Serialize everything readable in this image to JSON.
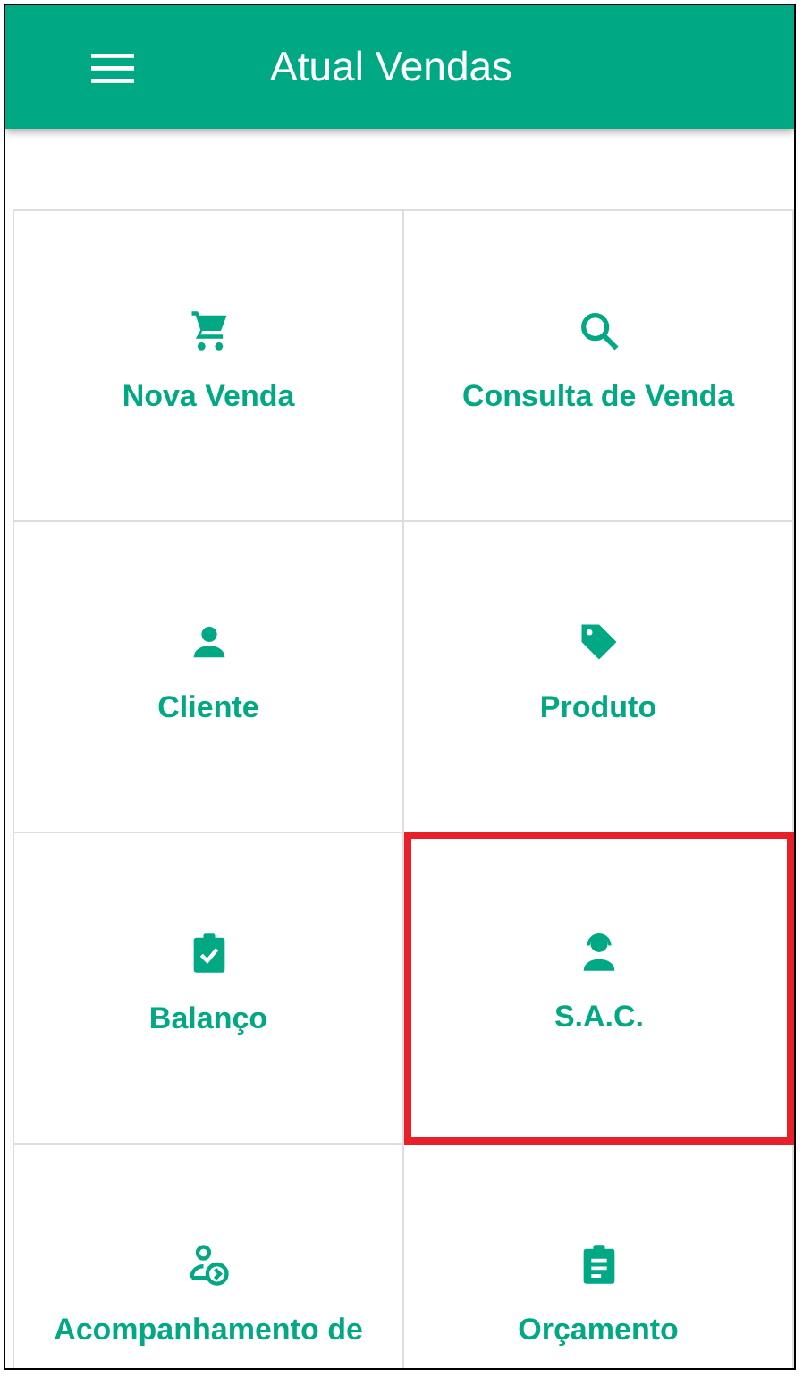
{
  "app_bar": {
    "title": "Atual Vendas"
  },
  "menu": [
    {
      "label": "Nova Venda",
      "selected": false
    },
    {
      "label": "Consulta de Venda",
      "selected": false
    },
    {
      "label": "Cliente",
      "selected": false
    },
    {
      "label": "Produto",
      "selected": false
    },
    {
      "label": "Balanço",
      "selected": false
    },
    {
      "label": "S.A.C.",
      "selected": true
    },
    {
      "label": "Acompanhamento de",
      "selected": false
    },
    {
      "label": "Orçamento",
      "selected": false
    }
  ]
}
